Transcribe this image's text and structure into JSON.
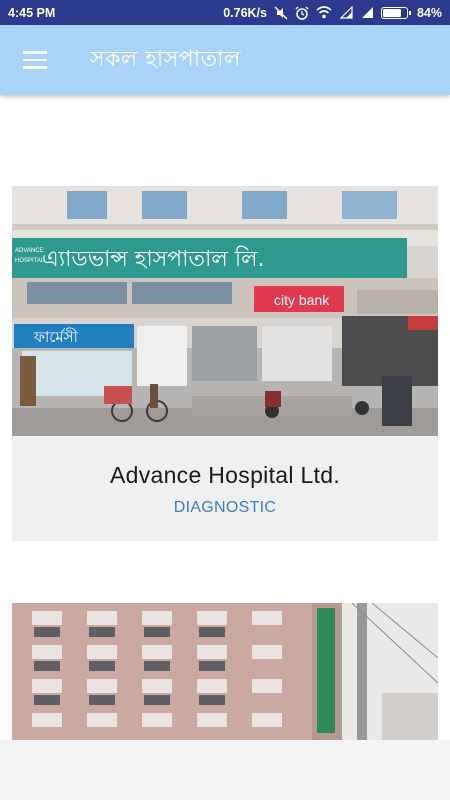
{
  "status_bar": {
    "time": "4:45 PM",
    "network_speed": "0.76K/s",
    "battery_percent": "84%",
    "battery_level": 0.84,
    "icons": [
      "mute-icon",
      "alarm-icon",
      "wifi-icon",
      "signal-icon",
      "signal-icon",
      "battery-icon"
    ]
  },
  "app_bar": {
    "title": "সকল হাসপাতাল",
    "menu_icon": "hamburger-menu-icon",
    "background": "#a9d3f7"
  },
  "hospitals": [
    {
      "name": "Advance Hospital Ltd.",
      "category": "DIAGNOSTIC",
      "photo_sign_banner": "এ্যাডভান্স হাসপাতাল লি.",
      "photo_sign_bank": "city bank",
      "photo_sign_pharmacy": "ফার্মেসী",
      "photo_sign_english": "ADVANCE",
      "photo_sign_english_2": "HOSPITAL"
    },
    {
      "name": "",
      "category": ""
    }
  ],
  "colors": {
    "status_bar": "#2b3a8c",
    "category_text": "#3d7fc4",
    "card_background": "#f0f0f0"
  }
}
